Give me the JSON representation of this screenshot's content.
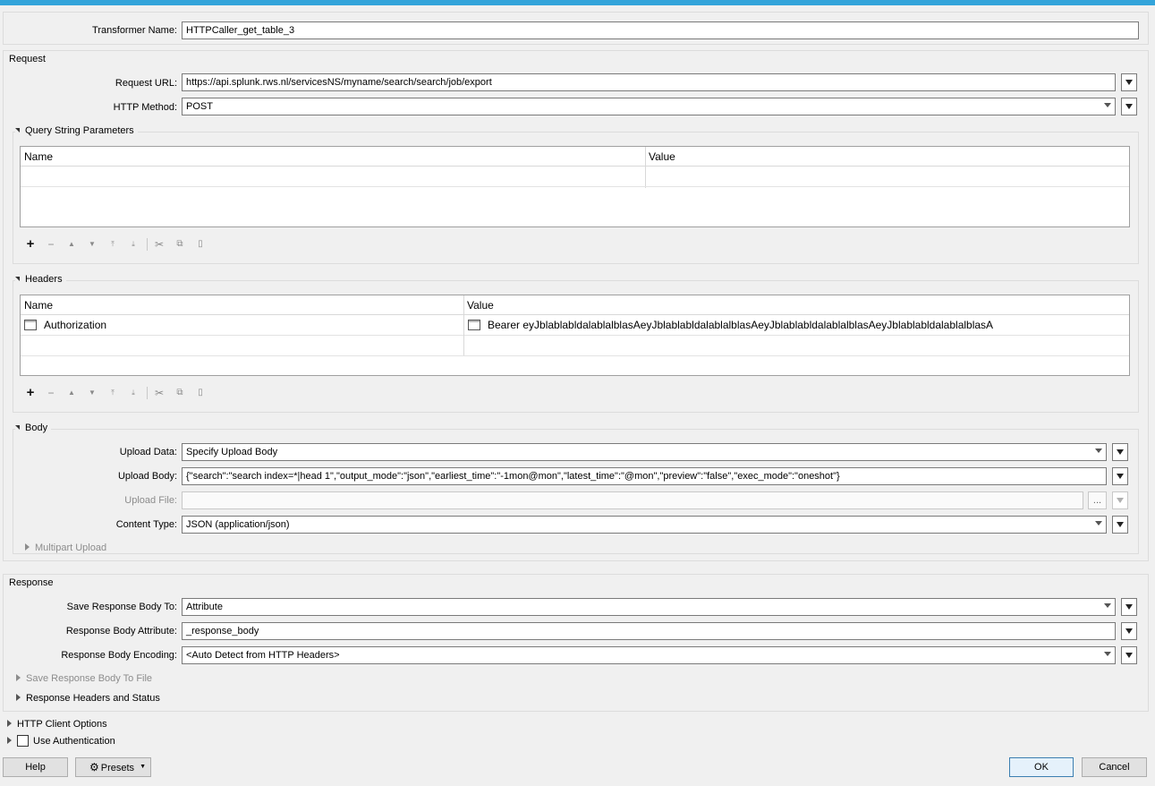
{
  "transformer": {
    "name_label": "Transformer Name:",
    "name_value": "HTTPCaller_get_table_3"
  },
  "request": {
    "title": "Request",
    "url_label": "Request URL:",
    "url_value": "https://api.splunk.rws.nl/servicesNS/myname/search/search/job/export",
    "method_label": "HTTP Method:",
    "method_value": "POST",
    "query_params": {
      "title": "Query String Parameters",
      "columns": [
        "Name",
        "Value"
      ],
      "rows": []
    },
    "headers": {
      "title": "Headers",
      "columns": [
        "Name",
        "Value"
      ],
      "rows": [
        {
          "name": "Authorization",
          "value": "Bearer eyJblablabldalablalblasAeyJblablabldalablalblasAeyJblablabldalablalblasAeyJblablabldalablalblasA"
        }
      ]
    }
  },
  "table_toolbar": {
    "icons": [
      "add-icon",
      "remove-icon",
      "move-up-icon",
      "move-down-icon",
      "move-top-icon",
      "move-bottom-icon",
      "cut-icon",
      "copy-icon",
      "paste-icon"
    ]
  },
  "body": {
    "title": "Body",
    "upload_data_label": "Upload Data:",
    "upload_data_value": "Specify Upload Body",
    "upload_body_label": "Upload Body:",
    "upload_body_value": "{\"search\":\"search index=*|head 1\",\"output_mode\":\"json\",\"earliest_time\":\"-1mon@mon\",\"latest_time\":\"@mon\",\"preview\":\"false\",\"exec_mode\":\"oneshot\"}",
    "upload_file_label": "Upload File:",
    "upload_file_value": "",
    "browse_label": "...",
    "content_type_label": "Content Type:",
    "content_type_value": "JSON (application/json)",
    "multipart_title": "Multipart Upload"
  },
  "response": {
    "title": "Response",
    "save_to_label": "Save Response Body To:",
    "save_to_value": "Attribute",
    "attr_label": "Response Body Attribute:",
    "attr_value": "_response_body",
    "encoding_label": "Response Body Encoding:",
    "encoding_value": "<Auto Detect from HTTP Headers>",
    "save_to_file_title": "Save Response Body To File",
    "headers_status_title": "Response Headers and Status"
  },
  "http_client_options_title": "HTTP Client Options",
  "use_authentication_label": "Use Authentication",
  "use_authentication_checked": false,
  "footer": {
    "help": "Help",
    "presets": "Presets",
    "ok": "OK",
    "cancel": "Cancel"
  },
  "colors": {
    "title_bar": "#33a4da",
    "default_button_border": "#3c7fb1"
  }
}
